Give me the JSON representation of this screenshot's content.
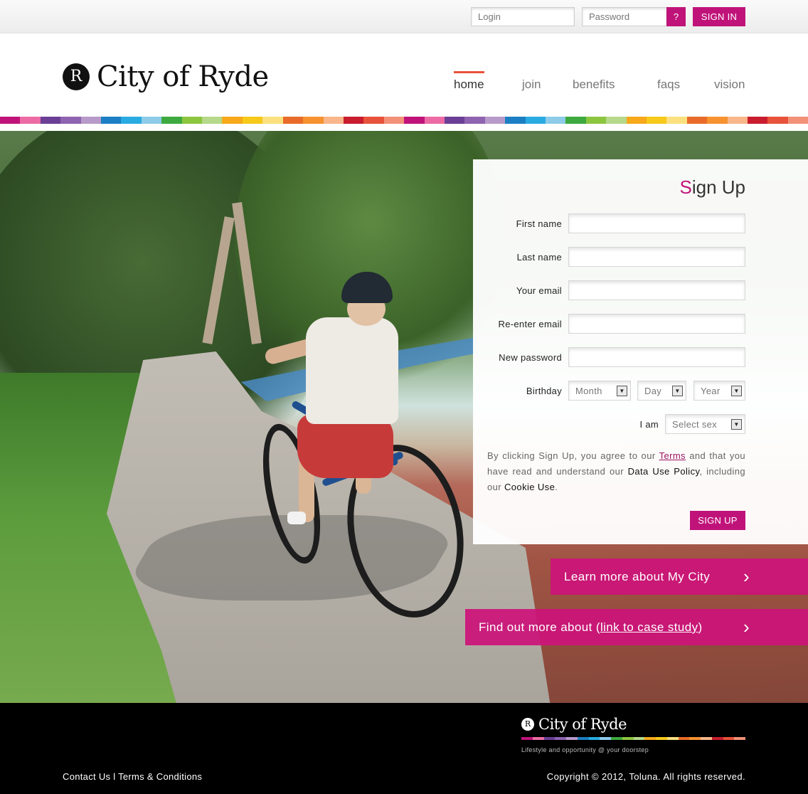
{
  "topbar": {
    "login_placeholder": "Login",
    "password_placeholder": "Password",
    "help_label": "?",
    "signin_label": "SIGN IN"
  },
  "header": {
    "logo_mark": "R",
    "logo_text": "City of Ryde",
    "nav": [
      {
        "label": "home",
        "active": true
      },
      {
        "label": "join",
        "active": false
      },
      {
        "label": "benefits",
        "active": false
      },
      {
        "label": "faqs",
        "active": false
      },
      {
        "label": "vision",
        "active": false
      }
    ]
  },
  "stripe_colors": [
    "#c0137a",
    "#ec6ba5",
    "#6a3f95",
    "#8e63b0",
    "#b79ac9",
    "#1c7fc4",
    "#29abe2",
    "#8dcbe9",
    "#3ea93e",
    "#8cc63f",
    "#b5d88a",
    "#f7a81b",
    "#f6c91a",
    "#fbe07f",
    "#e96b29",
    "#f6922f",
    "#f8b68a",
    "#c91c2e",
    "#e8523a",
    "#f29178"
  ],
  "signup": {
    "title_first": "S",
    "title_rest": "ign Up",
    "fields": [
      "First name",
      "Last name",
      "Your email",
      "Re-enter email",
      "New password"
    ],
    "birthday_label": "Birthday",
    "month": "Month",
    "day": "Day",
    "year": "Year",
    "iam_label": "I am",
    "sex_select": "Select sex",
    "terms": {
      "t1": "By clicking Sign Up, you agree to our ",
      "terms_link": "Terms",
      "t2": " and that you have read and understand our ",
      "data_use": "Data Use Policy",
      "t3": ", including  our ",
      "cookie": "Cookie Use",
      "t4": "."
    },
    "button": "SIGN UP"
  },
  "cta": {
    "learn_more": "Learn more about My City",
    "find_out_prefix": "Find out more about (",
    "find_out_link": "link to case study",
    "find_out_suffix": ")"
  },
  "footer": {
    "logo_mark": "R",
    "logo_text": "City of Ryde",
    "tagline": "Lifestyle and opportunity @ your doorstep",
    "contact": "Contact Us",
    "separator": " l ",
    "terms": "Terms & Conditions",
    "copyright": "Copyright © 2012, Toluna. All rights reserved."
  }
}
